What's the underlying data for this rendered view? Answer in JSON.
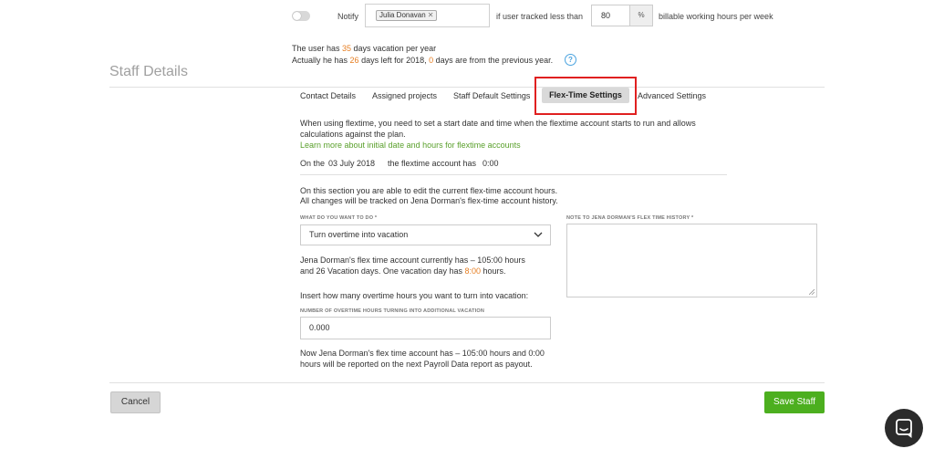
{
  "notify_row": {
    "notify_label": "Notify",
    "tag_user": "Julia Donavan",
    "tag_remove": "✕",
    "if_tracked_label": "if user tracked less than",
    "hours_value": "80",
    "percent_symbol": "%",
    "billable_label": "billable working hours per week"
  },
  "vacation": {
    "line1_pre": "The user has ",
    "line1_days": "35",
    "line1_post": " days vacation per year",
    "line2_pre": "Actually he has ",
    "line2_days": "26",
    "line2_mid": " days left for 2018, ",
    "line2_prev": "0",
    "line2_post": " days are from the previous year."
  },
  "section_title": "Staff Details",
  "tabs": {
    "contact": "Contact Details",
    "projects": "Assigned projects",
    "default_settings": "Staff Default Settings",
    "flextime": "Flex-Time Settings",
    "advanced": "Advanced Settings"
  },
  "flextime": {
    "intro": "When using flextime, you need to set a start date and time when the flextime account starts to run and allows calculations against the plan.",
    "learn_more": "Learn more about initial date and hours for flextime accounts",
    "on_the": "On the",
    "start_date": "03 July 2018",
    "account_has": "the flextime account has",
    "start_hours": "0:00",
    "edit_line1": "On this section you are able to edit the current flex-time account hours.",
    "edit_line2": "All changes will be tracked on Jena Dorman's flex-time account history.",
    "what_label": "WHAT DO YOU WANT TO DO *",
    "what_value": "Turn overtime into vacation",
    "note_label": "NOTE TO JENA DORMAN'S FLEX TIME HISTORY *",
    "current_line1": "Jena Dorman's flex time account currently has – 105:00 hours",
    "current_line2_pre": "and 26 Vacation days. One vacation day has ",
    "vacation_day_hours": "8:00",
    "current_line2_post": " hours.",
    "insert_prompt": "Insert how many overtime hours you want to turn into vacation:",
    "number_label": "NUMBER OF OVERTIME HOURS TURNING INTO ADDITIONAL VACATION",
    "number_value": "0.000",
    "result_line1": "Now Jena Dorman's flex time account has – 105:00 hours and 0:00",
    "result_line2": "hours will be reported on the next Payroll Data report as payout."
  },
  "buttons": {
    "cancel": "Cancel",
    "save": "Save Staff"
  },
  "colors": {
    "accent_orange": "#e67e22",
    "link_green": "#5aa02c",
    "save_green": "#4caf1f",
    "highlight_red": "#e02020"
  }
}
